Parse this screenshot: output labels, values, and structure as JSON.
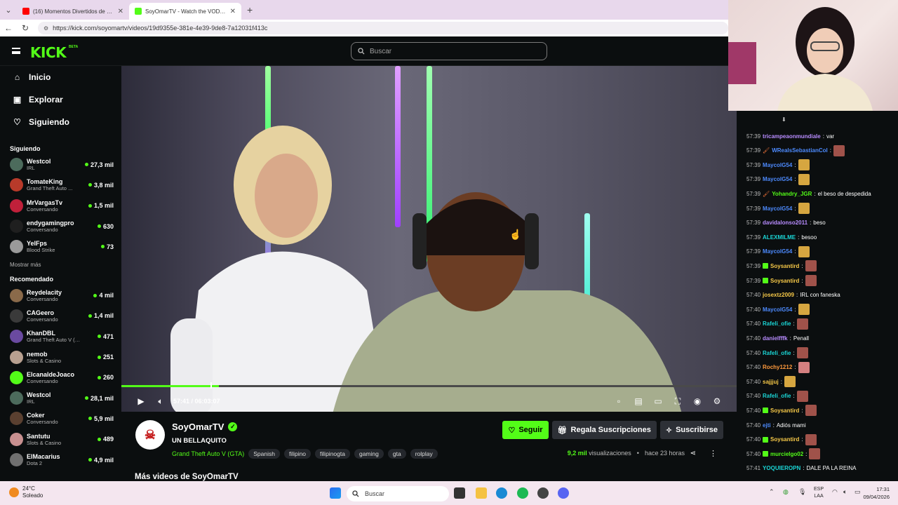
{
  "browser": {
    "tabs": [
      {
        "title": "(16) Momentos Divertidos de Crea",
        "color": "#ff0000"
      },
      {
        "title": "SoyOmarTV - Watch the VOD on K",
        "color": "#53fc18"
      }
    ],
    "new_tab": "+",
    "url": "https://kick.com/soyomartv/videos/19d9355e-381e-4e39-9de8-7a12031f413c"
  },
  "header": {
    "logo": "KICK",
    "beta": "BETA",
    "search_placeholder": "Buscar"
  },
  "sidebar": {
    "nav": [
      {
        "label": "Inicio",
        "icon": "home-icon"
      },
      {
        "label": "Explorar",
        "icon": "compass-icon"
      },
      {
        "label": "Siguiendo",
        "icon": "heart-icon"
      }
    ],
    "following_title": "Siguiendo",
    "following": [
      {
        "name": "Westcol",
        "sub": "IRL",
        "viewers": "27,3 mil",
        "color": "#4c6b5c"
      },
      {
        "name": "TomateKing",
        "sub": "Grand Theft Auto ...",
        "viewers": "3,8 mil",
        "color": "#b83a2a"
      },
      {
        "name": "MrVargasTv",
        "sub": "Conversando",
        "viewers": "1,5 mil",
        "color": "#c0203a"
      },
      {
        "name": "endygamingpro",
        "sub": "Conversando",
        "viewers": "630",
        "color": "#1f1f1f"
      },
      {
        "name": "YelFps",
        "sub": "Blood Strike",
        "viewers": "73",
        "color": "#9a9a9a"
      }
    ],
    "show_more": "Mostrar más",
    "recommended_title": "Recomendado",
    "recommended": [
      {
        "name": "Reydelacity",
        "sub": "Conversando",
        "viewers": "4 mil",
        "color": "#8a6a4a"
      },
      {
        "name": "CAGeero",
        "sub": "Conversando",
        "viewers": "1,4 mil",
        "color": "#3a3a3a"
      },
      {
        "name": "KhanDBL",
        "sub": "Grand Theft Auto V (G...",
        "viewers": "471",
        "color": "#6a4aa0"
      },
      {
        "name": "nemob",
        "sub": "Slots & Casino",
        "viewers": "251",
        "color": "#b8a090"
      },
      {
        "name": "ElcanaldeJoaco",
        "sub": "Conversando",
        "viewers": "260",
        "color": "#53fc18"
      },
      {
        "name": "Westcol",
        "sub": "IRL",
        "viewers": "28,1 mil",
        "color": "#4c6b5c"
      },
      {
        "name": "Coker",
        "sub": "Conversando",
        "viewers": "5,9 mil",
        "color": "#5a4030"
      },
      {
        "name": "Santutu",
        "sub": "Slots & Casino",
        "viewers": "489",
        "color": "#c89090"
      },
      {
        "name": "ElMacarius",
        "sub": "Dota 2",
        "viewers": "4,9 mil",
        "color": "#707070"
      }
    ]
  },
  "player": {
    "time": "57:41 / 06:03:07",
    "progress": 0.159
  },
  "video_info": {
    "channel": "SoyOmarTV",
    "title": "UN BELLAQUITO",
    "category": "Grand Theft Auto V (GTA)",
    "tags": [
      "Spanish",
      "filipino",
      "filipinogta",
      "gaming",
      "gta",
      "rolplay"
    ],
    "follow": "Seguir",
    "gift": "Regala Suscripciones",
    "subscribe": "Suscribirse",
    "views_num": "9,2 mil",
    "views_label": "visualizaciones",
    "ago": "hace 23 horas",
    "more_videos": "Más videos de SoyOmarTV"
  },
  "chat": [
    {
      "time": "57:39",
      "user": "tricampeaonmundiale",
      "color": "#b88cff",
      "text": "var",
      "emote": ""
    },
    {
      "time": "57:39",
      "user": "WRealsSebastianCol",
      "color": "#4d8bff",
      "text": "",
      "emote": "#a0524a"
    },
    {
      "time": "57:39",
      "user": "MaycolG54",
      "color": "#4d8bff",
      "text": "",
      "emote": "#d6a640"
    },
    {
      "time": "57:39",
      "user": "MaycolG54",
      "color": "#4d8bff",
      "text": "",
      "emote": "#d6a640"
    },
    {
      "time": "57:39",
      "user": "Yohandry_JGR",
      "color": "#53fc18",
      "text": "el beso de despedida",
      "emote": ""
    },
    {
      "time": "57:39",
      "user": "MaycolG54",
      "color": "#4d8bff",
      "text": "",
      "emote": "#d6a640"
    },
    {
      "time": "57:39",
      "user": "davidalonso2011",
      "color": "#b88cff",
      "text": "beso",
      "emote": ""
    },
    {
      "time": "57:39",
      "user": "ALEXMILME",
      "color": "#1ad6d6",
      "text": "besoo",
      "emote": ""
    },
    {
      "time": "57:39",
      "user": "MaycolG54",
      "color": "#4d8bff",
      "text": "",
      "emote": "#d6a640"
    },
    {
      "time": "57:39",
      "user": "Soysantird",
      "color": "#f7c948",
      "text": "",
      "emote": "#a0524a"
    },
    {
      "time": "57:39",
      "user": "Soysantird",
      "color": "#f7c948",
      "text": "",
      "emote": "#a0524a"
    },
    {
      "time": "57:40",
      "user": "josextz2009",
      "color": "#f7c948",
      "text": "IRL con faneska",
      "emote": ""
    },
    {
      "time": "57:40",
      "user": "MaycolG54",
      "color": "#4d8bff",
      "text": "",
      "emote": "#d6a640"
    },
    {
      "time": "57:40",
      "user": "Rafeli_ofie",
      "color": "#1ad6d6",
      "text": "",
      "emote": "#a0524a"
    },
    {
      "time": "57:40",
      "user": "danielfffk",
      "color": "#b88cff",
      "text": "Penall",
      "emote": ""
    },
    {
      "time": "57:40",
      "user": "Rafeli_ofie",
      "color": "#1ad6d6",
      "text": "",
      "emote": "#a0524a"
    },
    {
      "time": "57:40",
      "user": "Rochy1212",
      "color": "#ff9a3c",
      "text": "",
      "emote": "#d48080"
    },
    {
      "time": "57:40",
      "user": "sajjjuj",
      "color": "#f7c948",
      "text": "",
      "emote": "#d6a640"
    },
    {
      "time": "57:40",
      "user": "Rafeli_ofie",
      "color": "#1ad6d6",
      "text": "",
      "emote": "#a0524a"
    },
    {
      "time": "57:40",
      "user": "Soysantird",
      "color": "#f7c948",
      "text": "",
      "emote": "#a0524a"
    },
    {
      "time": "57:40",
      "user": "ejti",
      "color": "#4d8bff",
      "text": "Adiós mami",
      "emote": ""
    },
    {
      "time": "57:40",
      "user": "Soysantird",
      "color": "#f7c948",
      "text": "",
      "emote": "#a0524a"
    },
    {
      "time": "57:40",
      "user": "murcielgo02",
      "color": "#53fc18",
      "text": "",
      "emote": "#a0524a"
    },
    {
      "time": "57:41",
      "user": "YOQUIEROPN",
      "color": "#1ad6d6",
      "text": "DALE PA LA REINA",
      "emote": ""
    }
  ],
  "taskbar": {
    "temp": "24°C",
    "weather": "Soleado",
    "search": "Buscar",
    "lang1": "ESP",
    "lang2": "LAA",
    "time": "17:31",
    "date": "09/04/2026"
  }
}
